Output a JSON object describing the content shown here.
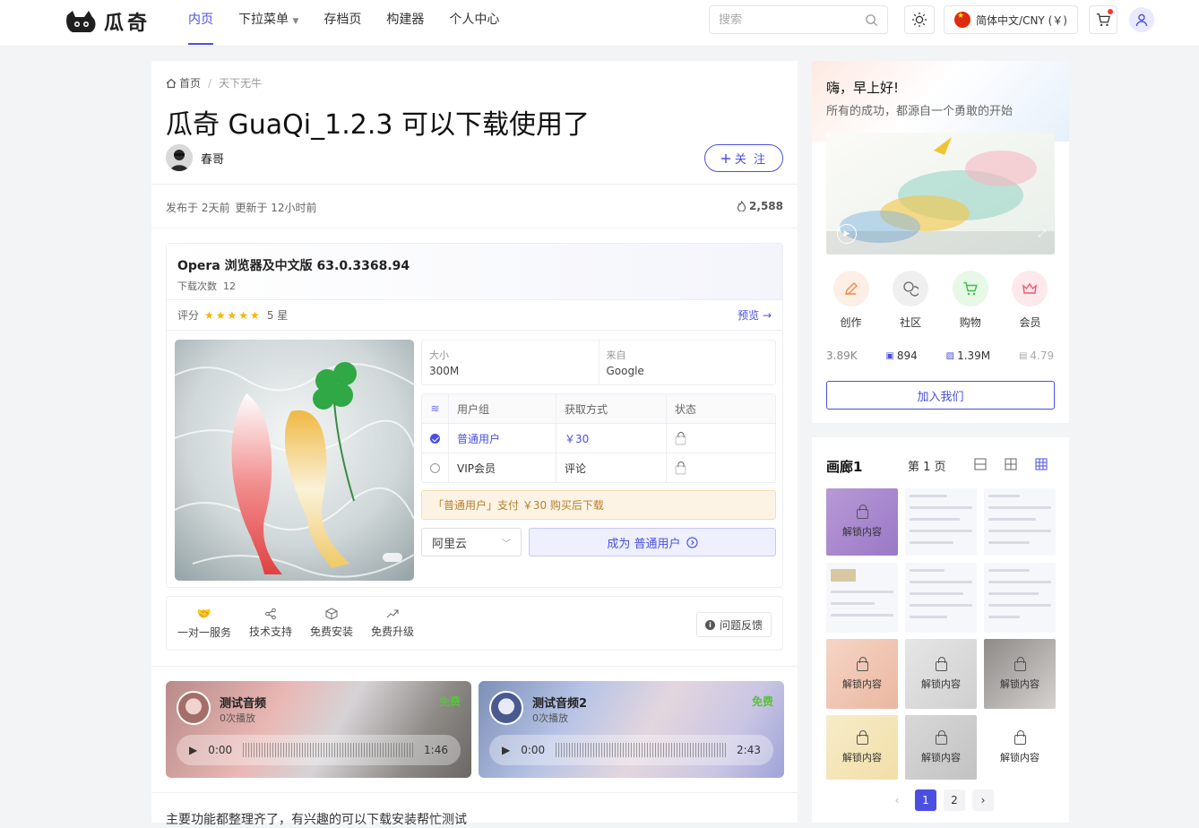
{
  "header": {
    "logo_text": "瓜奇",
    "nav": [
      {
        "label": "内页",
        "active": true
      },
      {
        "label": "下拉菜单",
        "dropdown": true
      },
      {
        "label": "存档页"
      },
      {
        "label": "构建器"
      },
      {
        "label": "个人中心"
      }
    ],
    "search_placeholder": "搜索",
    "language": "简体中文/CNY (￥)",
    "accent_color": "#4b4fe0"
  },
  "article": {
    "breadcrumb_home": "首页",
    "breadcrumb_current": "天下无牛",
    "title": "瓜奇 GuaQi_1.2.3 可以下载使用了",
    "author": "春哥",
    "follow_label": "关 注",
    "published": "发布于 2天前",
    "updated": "更新于 12小时前",
    "views": "2,588"
  },
  "download": {
    "name": "Opera 浏览器及中文版 63.0.3368.94",
    "count_label": "下载次数",
    "count": "12",
    "rating_label": "评分",
    "stars": "★★★★★",
    "rating": "5 星",
    "preview": "预览",
    "size_label": "大小",
    "size": "300M",
    "source_label": "来自",
    "source": "Google",
    "table_headers": [
      "用户组",
      "获取方式",
      "状态"
    ],
    "rows": [
      {
        "group": "普通用户",
        "method": "￥30",
        "selected": true
      },
      {
        "group": "VIP会员",
        "method": "评论",
        "selected": false
      }
    ],
    "notice": "「普通用户」支付 ￥30 购买后下载",
    "mirror": "阿里云",
    "buy_label": "成为 普通用户",
    "services": [
      "一对一服务",
      "技术支持",
      "免费安装",
      "免费升级"
    ],
    "report": "问题反馈"
  },
  "audios": [
    {
      "title": "测试音频",
      "plays": "0次播放",
      "badge": "免费",
      "time": "0:00",
      "duration": "1:46"
    },
    {
      "title": "测试音频2",
      "plays": "0次播放",
      "badge": "免费",
      "time": "0:00",
      "duration": "2:43"
    }
  ],
  "bottom_text": "主要功能都整理齐了，有兴趣的可以下载安装帮忙测试",
  "sidebar": {
    "greeting": "嗨，早上好!",
    "motto": "所有的成功，都源自一个勇敢的开始",
    "quick": [
      {
        "label": "创作",
        "icon": "pencil-icon",
        "bg": "#fdeee6",
        "color": "#f08a4b"
      },
      {
        "label": "社区",
        "icon": "chat-icon",
        "bg": "#efefef",
        "color": "#666"
      },
      {
        "label": "购物",
        "icon": "cart-icon",
        "bg": "#e6f8e6",
        "color": "#3cbf48"
      },
      {
        "label": "会员",
        "icon": "crown-icon",
        "bg": "#fde8ec",
        "color": "#f0566e"
      }
    ],
    "stats": [
      "3.89K",
      "894",
      "1.39M",
      "4.79K"
    ],
    "join_label": "加入我们"
  },
  "gallery": {
    "title": "画廊1",
    "page_label": "第 1 页",
    "unlock_label": "解锁内容",
    "pages": [
      "1",
      "2"
    ]
  }
}
